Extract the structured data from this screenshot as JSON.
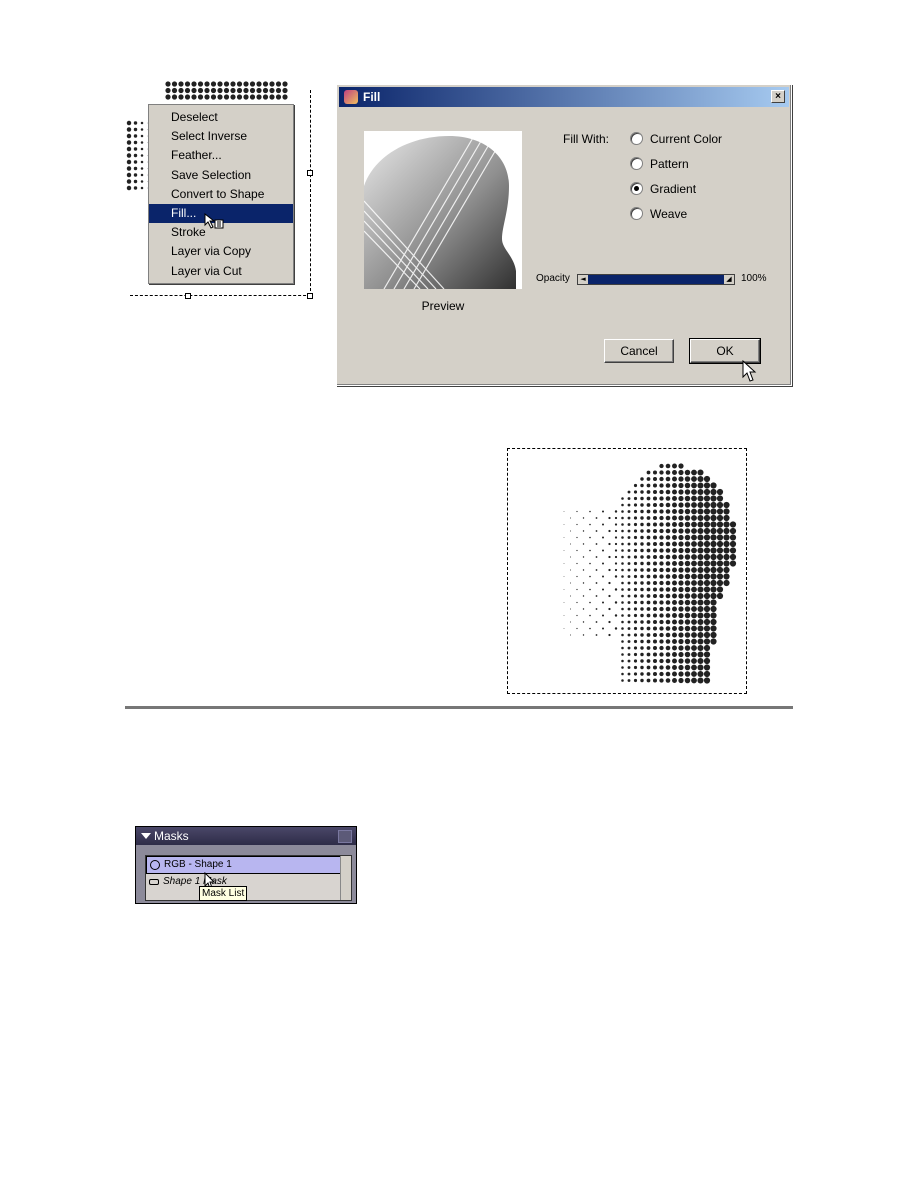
{
  "context_menu": {
    "items": [
      {
        "label": "Deselect"
      },
      {
        "label": "Select Inverse"
      },
      {
        "label": "Feather..."
      },
      {
        "label": "Save Selection"
      },
      {
        "label": "Convert to Shape"
      },
      {
        "label": "Fill...",
        "active": true
      },
      {
        "label": "Stroke"
      },
      {
        "label": "Layer via Copy"
      },
      {
        "label": "Layer via Cut"
      }
    ]
  },
  "fill_dialog": {
    "title": "Fill",
    "close_glyph": "×",
    "preview_label": "Preview",
    "fill_with_label": "Fill With:",
    "options": [
      {
        "label": "Current Color",
        "checked": false
      },
      {
        "label": "Pattern",
        "checked": false
      },
      {
        "label": "Gradient",
        "checked": true
      },
      {
        "label": "Weave",
        "checked": false
      }
    ],
    "opacity_label": "Opacity",
    "opacity_value": "100%",
    "opacity_fraction": 1.0,
    "cancel_label": "Cancel",
    "ok_label": "OK"
  },
  "masks_panel": {
    "title": "Masks",
    "rows": [
      {
        "label": "RGB - Shape 1",
        "selected": true
      },
      {
        "label": "Shape 1 Mask",
        "selected": false
      }
    ],
    "tooltip": "Mask List"
  },
  "colors": {
    "selection_blue": "#0a246a",
    "dialog_gray": "#d4d0c8",
    "panel_header": "#3a3858",
    "mask_selected": "#b8b6f0"
  },
  "icons": [
    "fill-app-icon",
    "close-icon",
    "radio-icon",
    "mouse-pointer-icon",
    "eye-icon",
    "link-icon",
    "collapse-triangle-icon"
  ]
}
